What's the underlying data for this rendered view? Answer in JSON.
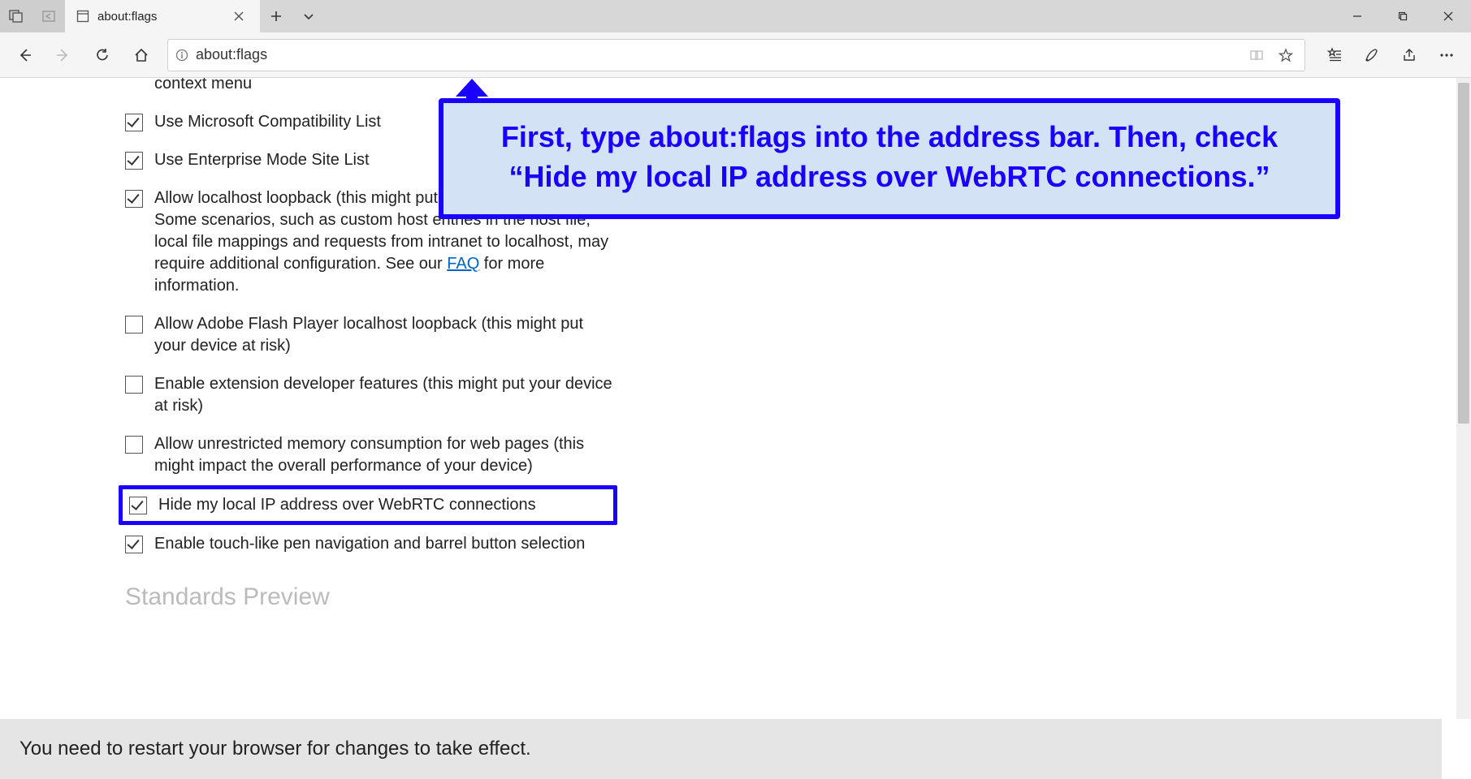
{
  "titlebar": {
    "tab_title": "about:flags"
  },
  "navbar": {
    "address_value": "about:flags",
    "icons": {
      "back": "back-icon",
      "forward": "forward-icon",
      "refresh": "refresh-icon",
      "home": "home-icon",
      "info": "info-icon",
      "reading": "reading-icon",
      "favorite": "favorite-icon",
      "favorites_list": "favorites-list-icon",
      "notes": "notes-icon",
      "share": "share-icon",
      "more": "more-icon"
    }
  },
  "options": {
    "context_menu_tail": "context menu",
    "compat_list": "Use Microsoft Compatibility List",
    "enterprise_list": "Use Enterprise Mode Site List",
    "localhost_loopback_pre": "Allow localhost loopback (this might put your device at risk). Some scenarios, such as custom host entries in the host file, local file mappings and requests from intranet to localhost, may require additional configuration. See our ",
    "localhost_loopback_link": "FAQ",
    "localhost_loopback_post": " for more information.",
    "flash_loopback": "Allow Adobe Flash Player localhost loopback (this might put your device at risk)",
    "ext_dev": "Enable extension developer features (this might put your device at risk)",
    "unrestricted_mem": "Allow unrestricted memory consumption for web pages (this might impact the overall performance of your device)",
    "hide_ip_webrtc": "Hide my local IP address over WebRTC connections",
    "pen_nav": "Enable touch-like pen navigation and barrel button selection",
    "standards_preview": "Standards Preview"
  },
  "callout": {
    "text": "First, type about:flags into the address bar. Then, check “Hide my local IP address over WebRTC connections.”"
  },
  "footer": {
    "restart_msg": "You need to restart your browser for changes to take effect."
  },
  "colors": {
    "accent_blue": "#1a00ff",
    "callout_bg": "#d3e2f4",
    "link_blue": "#0064c8"
  }
}
